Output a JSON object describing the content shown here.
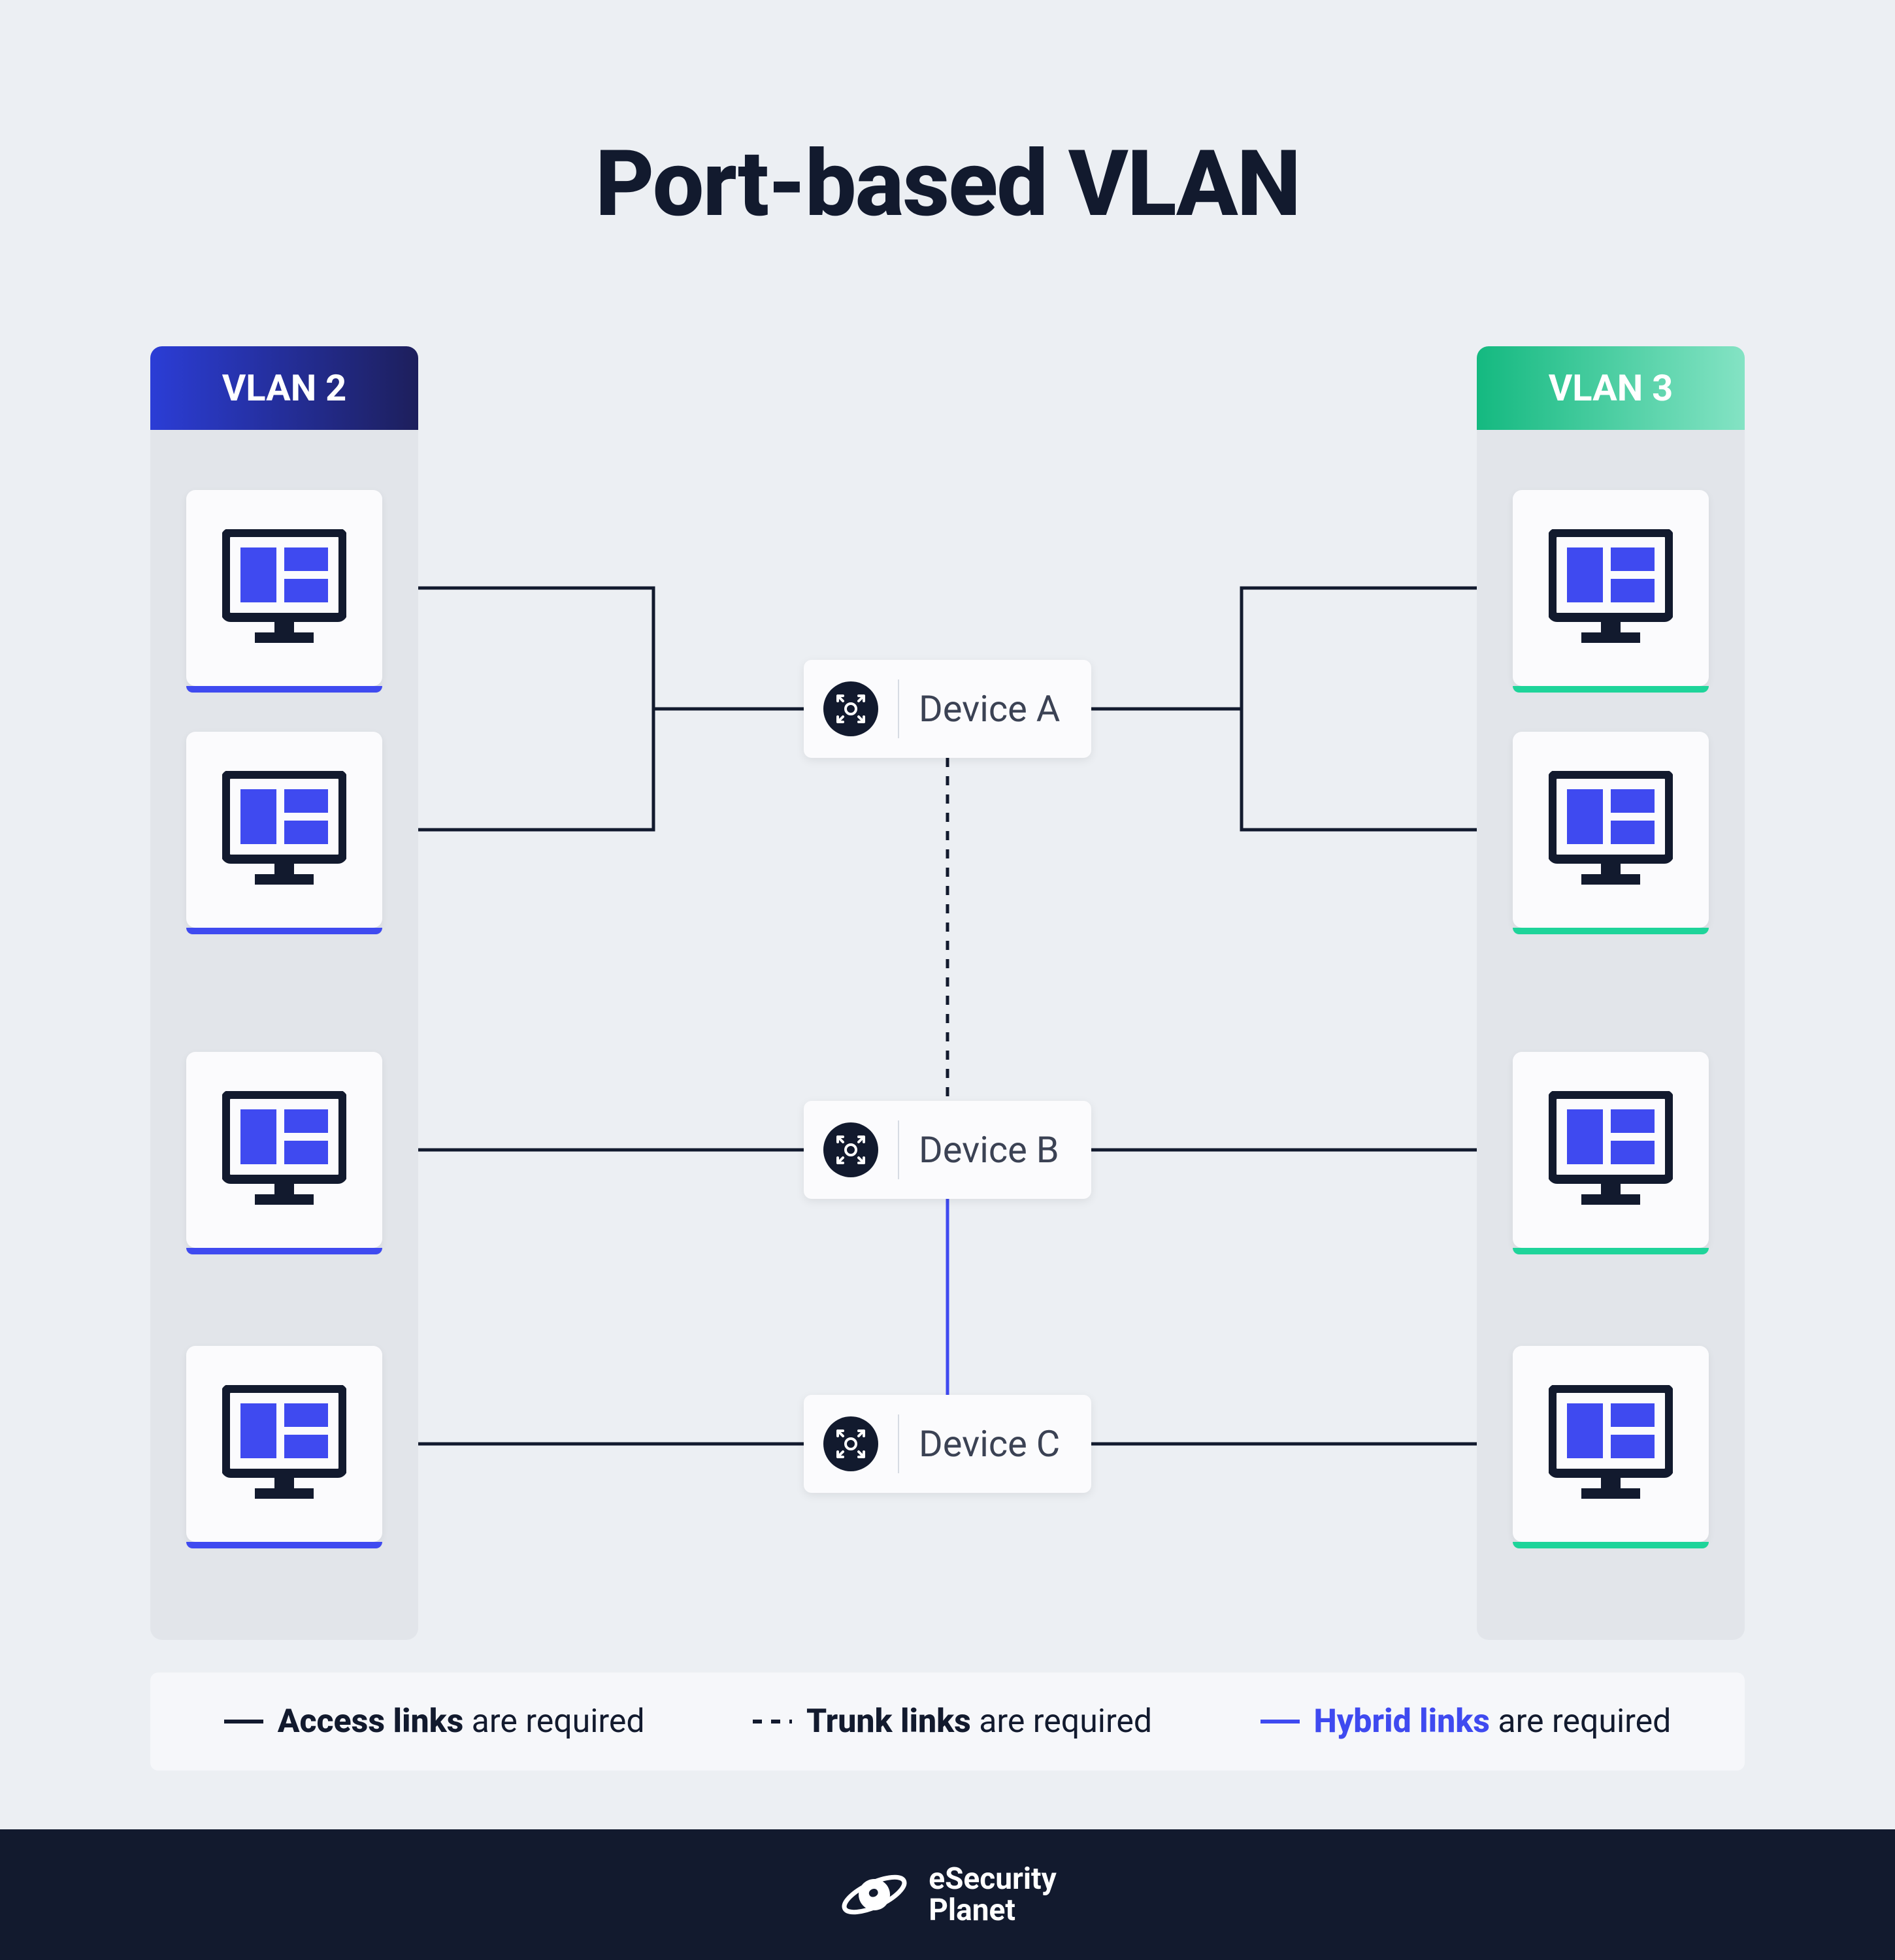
{
  "title": "Port-based VLAN",
  "vlans": {
    "left": {
      "name": "VLAN 2"
    },
    "right": {
      "name": "VLAN 3"
    }
  },
  "devices": {
    "a": "Device A",
    "b": "Device B",
    "c": "Device C"
  },
  "legend": {
    "access": {
      "bold": "Access links",
      "rest": " are required"
    },
    "trunk": {
      "bold": "Trunk links",
      "rest": " are required"
    },
    "hybrid": {
      "bold": "Hybrid links",
      "rest": " are required"
    }
  },
  "brand": {
    "line1": "eSecurity",
    "line2": "Planet"
  },
  "colors": {
    "dark": "#121a2e",
    "blue": "#3f4af0",
    "green": "#1ed49a"
  }
}
